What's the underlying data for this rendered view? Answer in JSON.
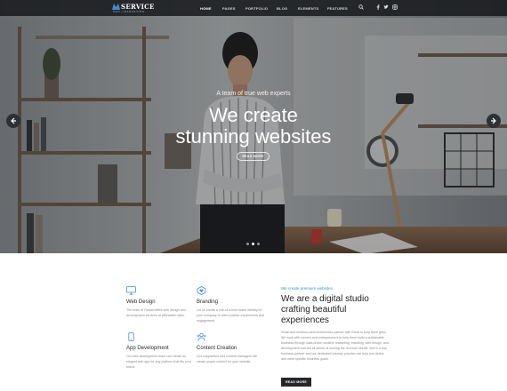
{
  "brand": {
    "logo_text": "SERVICE",
    "logo_subtitle": "SEO / MARKETING",
    "accent_color": "#3e8fd6"
  },
  "nav": {
    "items": [
      "HOME",
      "PAGES",
      "PORTFOLIO",
      "BLOG",
      "ELEMENTS",
      "FEATURES"
    ],
    "active": "HOME",
    "icons": [
      "search-icon",
      "facebook-icon",
      "twitter-icon",
      "instagram-icon"
    ]
  },
  "hero": {
    "eyebrow": "A team of true web experts",
    "headline_line1": "We create",
    "headline_line2": "stunning websites",
    "button_label": "READ MORE",
    "slide_count": 3,
    "active_slide": 2
  },
  "features": [
    {
      "icon": "monitor-icon",
      "title": "Web Design",
      "desc": "The team of Global offers web design and development services at affordable rates."
    },
    {
      "icon": "heart-badge-icon",
      "title": "Branding",
      "desc": "Let us create a one-of-a-kind brand identity for your company to drive positive experiences and engagement."
    },
    {
      "icon": "smartphone-icon",
      "title": "App Development",
      "desc": "Our web development team can create an elegant web app for any platform that fits your brand."
    },
    {
      "icon": "users-icon",
      "title": "Content Creation",
      "desc": "Our copywriters and content managers will create proper content for your website."
    }
  ],
  "about": {
    "eyebrow": "We create premium websites",
    "title": "We are a digital studio crafting beautiful experiences",
    "body": "Small and medium-sized businesses partner with Great to help them grow. We work with owners and entrepreneurs to help them build a sustainable business through data-driven creative marketing, branding, web design, and development that are all aimed at moving the revenue needle. We're a true business partner and our dedicated industry practice can help you define and meet specific business goals.",
    "button_label": "READ MORE"
  }
}
